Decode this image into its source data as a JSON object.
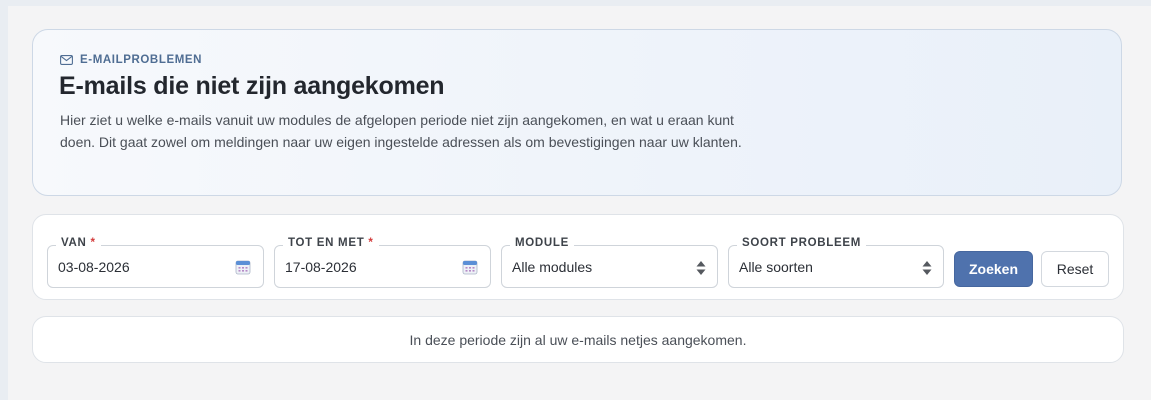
{
  "header": {
    "eyebrow": "E-MAILPROBLEMEN",
    "eyebrow_icon": "mail-icon",
    "title": "E-mails die niet zijn aangekomen",
    "description": "Hier ziet u welke e-mails vanuit uw modules de afgelopen periode niet zijn aangekomen, en wat u eraan kunt doen. Dit gaat zowel om meldingen naar uw eigen ingestelde adressen als om bevestigingen naar uw klanten."
  },
  "filters": {
    "from": {
      "label": "VAN",
      "required_mark": "*",
      "value": "03-08-2026",
      "icon": "calendar-icon"
    },
    "to": {
      "label": "TOT EN MET",
      "required_mark": "*",
      "value": "17-08-2026",
      "icon": "calendar-icon"
    },
    "module": {
      "label": "MODULE",
      "value": "Alle modules",
      "icon": "sort-arrows-icon"
    },
    "problem_type": {
      "label": "SOORT PROBLEEM",
      "value": "Alle soorten",
      "icon": "sort-arrows-icon"
    },
    "search_button": "Zoeken",
    "reset_button": "Reset"
  },
  "results": {
    "empty_message": "In deze periode zijn al uw e-mails netjes aangekomen."
  },
  "colors": {
    "accent": "#4f72ad",
    "eyebrow": "#4f6d93",
    "required": "#d33b3b"
  }
}
